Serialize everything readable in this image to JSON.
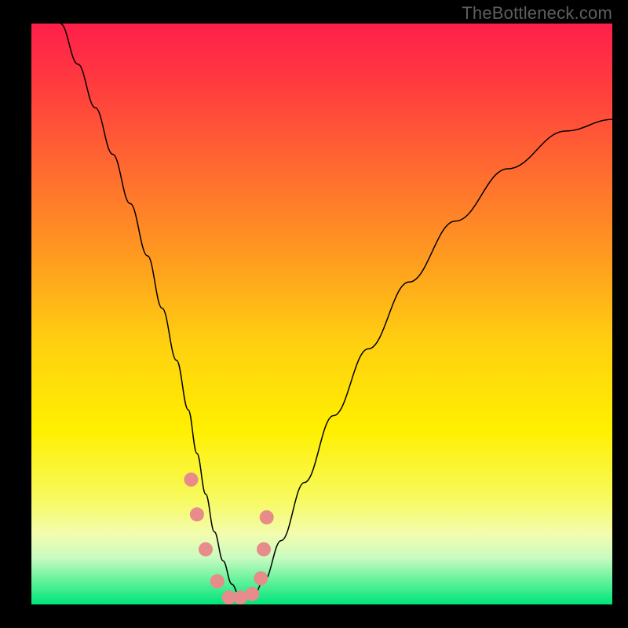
{
  "watermark": {
    "text": "TheBottleneck.com"
  },
  "chart_data": {
    "type": "line",
    "title": "",
    "xlabel": "",
    "ylabel": "",
    "xlim": [
      0,
      1
    ],
    "ylim": [
      0,
      1
    ],
    "background_gradient": {
      "stops": [
        {
          "pos": 0.0,
          "color": "#ff1f4b"
        },
        {
          "pos": 0.1,
          "color": "#ff3a3f"
        },
        {
          "pos": 0.25,
          "color": "#ff6a30"
        },
        {
          "pos": 0.4,
          "color": "#ff9a20"
        },
        {
          "pos": 0.55,
          "color": "#ffd010"
        },
        {
          "pos": 0.7,
          "color": "#fff000"
        },
        {
          "pos": 0.82,
          "color": "#f7fa60"
        },
        {
          "pos": 0.88,
          "color": "#f2fcb0"
        },
        {
          "pos": 0.92,
          "color": "#c8fbc0"
        },
        {
          "pos": 0.96,
          "color": "#60f29a"
        },
        {
          "pos": 1.0,
          "color": "#00e47a"
        }
      ]
    },
    "series": [
      {
        "name": "bottleneck-curve",
        "color": "#000000",
        "stroke_width": 1.5,
        "x": [
          0.05,
          0.08,
          0.11,
          0.14,
          0.17,
          0.2,
          0.225,
          0.25,
          0.27,
          0.285,
          0.3,
          0.315,
          0.33,
          0.345,
          0.36,
          0.38,
          0.4,
          0.43,
          0.47,
          0.52,
          0.58,
          0.65,
          0.73,
          0.82,
          0.92,
          1.0
        ],
        "values": [
          1.0,
          0.93,
          0.855,
          0.775,
          0.69,
          0.6,
          0.51,
          0.42,
          0.335,
          0.26,
          0.19,
          0.125,
          0.075,
          0.035,
          0.01,
          0.01,
          0.04,
          0.11,
          0.21,
          0.325,
          0.44,
          0.555,
          0.66,
          0.75,
          0.815,
          0.835
        ]
      },
      {
        "name": "highlighted-points",
        "color": "#e78b8b",
        "type": "scatter",
        "marker_radius": 9,
        "x": [
          0.275,
          0.285,
          0.3,
          0.32,
          0.34,
          0.36,
          0.38,
          0.395,
          0.4,
          0.405
        ],
        "values": [
          0.215,
          0.155,
          0.095,
          0.04,
          0.012,
          0.012,
          0.018,
          0.045,
          0.095,
          0.15
        ]
      }
    ]
  }
}
